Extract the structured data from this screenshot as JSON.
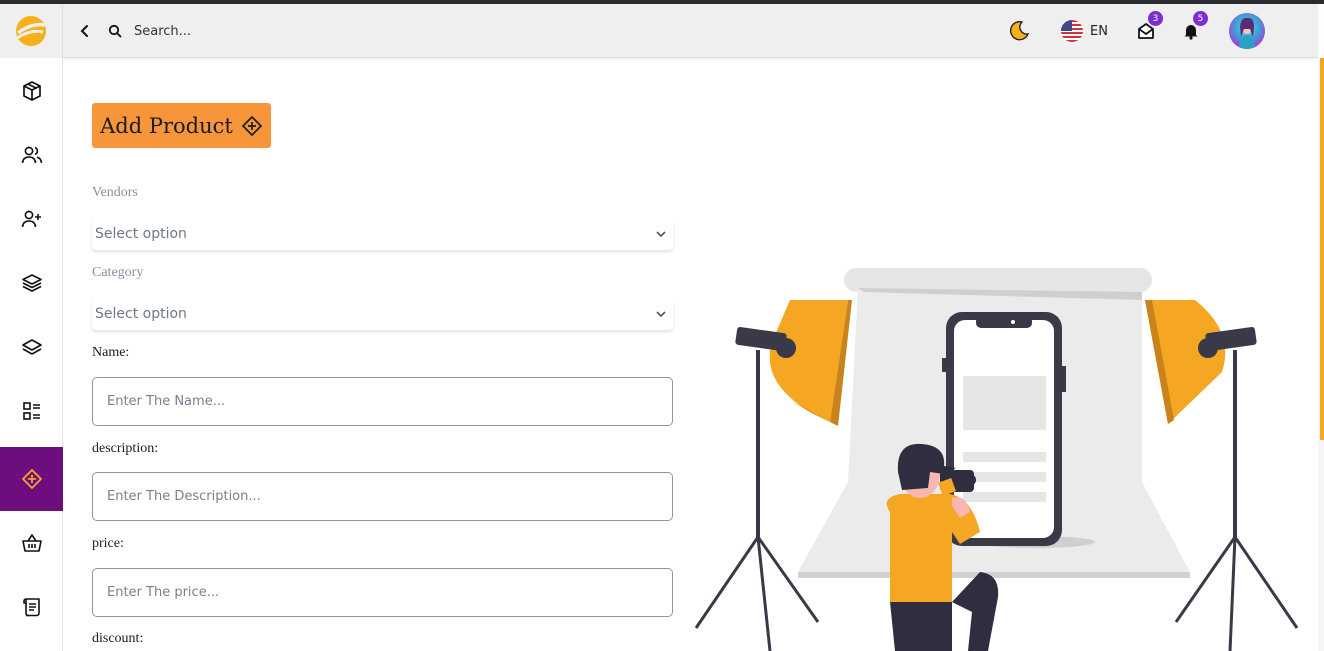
{
  "topbar": {
    "search_placeholder": "Search...",
    "language": "EN",
    "mail_badge": "3",
    "notification_badge": "5"
  },
  "sidebar": {
    "items": [
      {
        "icon": "box-icon"
      },
      {
        "icon": "users-icon"
      },
      {
        "icon": "user-plus-icon"
      },
      {
        "icon": "layers-icon"
      },
      {
        "icon": "stack-icon"
      },
      {
        "icon": "list-icon"
      },
      {
        "icon": "add-circle-icon",
        "active": true
      },
      {
        "icon": "basket-icon"
      },
      {
        "icon": "scroll-icon"
      }
    ]
  },
  "form": {
    "title": "Add Product",
    "vendors_label": "Vendors",
    "vendors_value": "Select option",
    "category_label": "Category",
    "category_value": "Select option",
    "name_label": "Name:",
    "name_placeholder": "Enter The Name...",
    "description_label": "description:",
    "description_placeholder": "Enter The Description...",
    "price_label": "price:",
    "price_placeholder": "Enter The price...",
    "discount_label": "discount:"
  },
  "colors": {
    "accent": "#f7953a",
    "sidebar_active": "#6e0d7e",
    "badge": "#7b2fd0"
  }
}
